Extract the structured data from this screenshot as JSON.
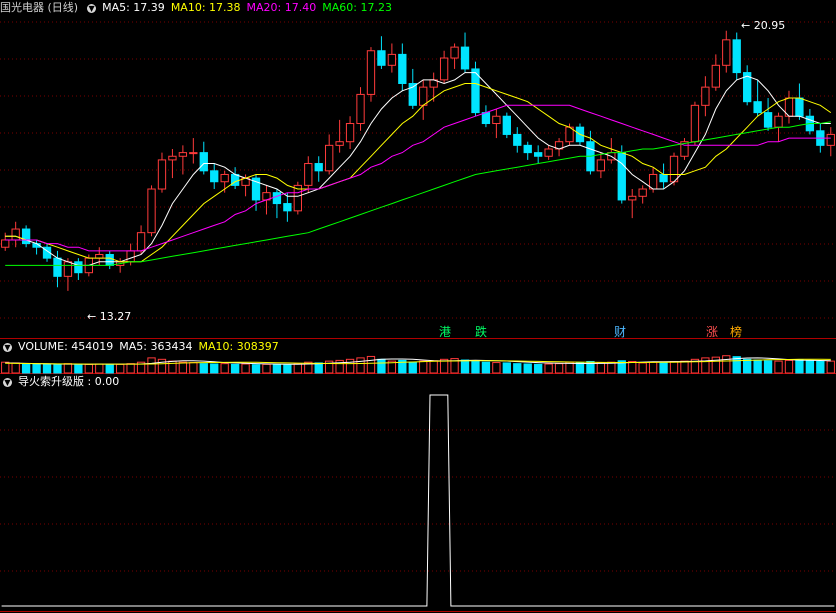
{
  "main": {
    "title": "国光电器 (日线)",
    "ma5": "MA5: 17.39",
    "ma10": "MA10: 17.38",
    "ma20": "MA20: 17.40",
    "ma60": "MA60: 17.23",
    "high_label": "20.95",
    "low_label": "13.27",
    "tags": [
      "港",
      "跌",
      "财",
      "涨",
      "榜"
    ]
  },
  "volume": {
    "label": "VOLUME: 454019",
    "ma5": "MA5: 363434",
    "ma10": "MA10: 308397"
  },
  "indicator": {
    "label": "导火索升级版 : 0.00"
  },
  "colors": {
    "up": "#ff3b3b",
    "down": "#00e4ff",
    "ma5": "#ffffff",
    "ma10": "#ffff00",
    "ma20": "#ff00ff",
    "ma60": "#00ff00",
    "grid": "#7a0000"
  },
  "chart_data": [
    {
      "type": "candlestick",
      "ohlc": [
        [
          15.0,
          15.4,
          14.9,
          15.2
        ],
        [
          15.2,
          15.7,
          15.0,
          15.5
        ],
        [
          15.5,
          15.6,
          15.0,
          15.1
        ],
        [
          15.1,
          15.2,
          14.8,
          15.0
        ],
        [
          15.0,
          15.1,
          14.6,
          14.7
        ],
        [
          14.7,
          14.9,
          13.9,
          14.2
        ],
        [
          14.2,
          14.7,
          13.8,
          14.6
        ],
        [
          14.6,
          14.7,
          14.1,
          14.3
        ],
        [
          14.3,
          14.8,
          14.2,
          14.7
        ],
        [
          14.7,
          15.0,
          14.5,
          14.8
        ],
        [
          14.8,
          14.9,
          14.4,
          14.5
        ],
        [
          14.5,
          14.7,
          14.3,
          14.6
        ],
        [
          14.6,
          15.1,
          14.5,
          14.9
        ],
        [
          14.9,
          15.6,
          14.8,
          15.4
        ],
        [
          15.4,
          16.7,
          15.3,
          16.6
        ],
        [
          16.6,
          17.6,
          16.5,
          17.4
        ],
        [
          17.4,
          17.7,
          16.9,
          17.5
        ],
        [
          17.5,
          17.8,
          17.0,
          17.6
        ],
        [
          17.6,
          18.0,
          17.3,
          17.6
        ],
        [
          17.6,
          17.9,
          17.0,
          17.1
        ],
        [
          17.1,
          17.3,
          16.6,
          16.8
        ],
        [
          16.8,
          17.1,
          16.5,
          17.0
        ],
        [
          17.0,
          17.2,
          16.6,
          16.7
        ],
        [
          16.7,
          17.0,
          16.4,
          16.9
        ],
        [
          16.9,
          17.0,
          16.0,
          16.3
        ],
        [
          16.3,
          16.7,
          15.9,
          16.5
        ],
        [
          16.5,
          16.6,
          15.8,
          16.2
        ],
        [
          16.2,
          16.5,
          15.7,
          16.0
        ],
        [
          16.0,
          16.8,
          15.9,
          16.7
        ],
        [
          16.7,
          17.5,
          16.5,
          17.3
        ],
        [
          17.3,
          17.5,
          16.8,
          17.1
        ],
        [
          17.1,
          18.1,
          17.0,
          17.8
        ],
        [
          17.8,
          18.5,
          17.6,
          17.9
        ],
        [
          17.9,
          18.6,
          17.7,
          18.4
        ],
        [
          18.4,
          19.4,
          18.2,
          19.2
        ],
        [
          19.2,
          20.5,
          19.0,
          20.4
        ],
        [
          20.4,
          20.8,
          19.9,
          20.0
        ],
        [
          20.0,
          20.6,
          19.8,
          20.3
        ],
        [
          20.3,
          20.6,
          19.3,
          19.5
        ],
        [
          19.5,
          19.9,
          18.8,
          18.9
        ],
        [
          18.9,
          19.6,
          18.5,
          19.4
        ],
        [
          19.4,
          19.8,
          19.0,
          19.6
        ],
        [
          19.6,
          20.4,
          19.5,
          20.2
        ],
        [
          20.2,
          20.6,
          19.9,
          20.5
        ],
        [
          20.5,
          20.9,
          19.8,
          19.9
        ],
        [
          19.9,
          20.1,
          18.6,
          18.7
        ],
        [
          18.7,
          18.9,
          18.3,
          18.4
        ],
        [
          18.4,
          18.8,
          18.0,
          18.6
        ],
        [
          18.6,
          18.7,
          18.0,
          18.1
        ],
        [
          18.1,
          18.3,
          17.6,
          17.8
        ],
        [
          17.8,
          17.9,
          17.4,
          17.6
        ],
        [
          17.6,
          17.8,
          17.3,
          17.5
        ],
        [
          17.5,
          17.8,
          17.4,
          17.7
        ],
        [
          17.7,
          18.0,
          17.5,
          17.9
        ],
        [
          17.9,
          18.4,
          17.8,
          18.3
        ],
        [
          18.3,
          18.4,
          17.8,
          17.9
        ],
        [
          17.9,
          18.2,
          17.0,
          17.1
        ],
        [
          17.1,
          17.6,
          16.9,
          17.4
        ],
        [
          17.4,
          18.0,
          17.3,
          17.6
        ],
        [
          17.6,
          17.8,
          16.2,
          16.3
        ],
        [
          16.3,
          16.6,
          15.8,
          16.4
        ],
        [
          16.4,
          16.7,
          16.2,
          16.6
        ],
        [
          16.6,
          17.2,
          16.5,
          17.0
        ],
        [
          17.0,
          17.3,
          16.6,
          16.8
        ],
        [
          16.8,
          17.6,
          16.7,
          17.5
        ],
        [
          17.5,
          18.0,
          17.4,
          17.9
        ],
        [
          17.9,
          19.0,
          17.8,
          18.9
        ],
        [
          18.9,
          19.7,
          18.6,
          19.4
        ],
        [
          19.4,
          20.3,
          19.3,
          20.0
        ],
        [
          20.0,
          20.95,
          19.8,
          20.7
        ],
        [
          20.7,
          20.9,
          19.6,
          19.8
        ],
        [
          19.8,
          20.0,
          18.9,
          19.0
        ],
        [
          19.0,
          19.6,
          18.6,
          18.7
        ],
        [
          18.7,
          19.1,
          18.2,
          18.3
        ],
        [
          18.3,
          18.7,
          17.9,
          18.6
        ],
        [
          18.6,
          19.3,
          18.4,
          19.1
        ],
        [
          19.1,
          19.5,
          18.5,
          18.6
        ],
        [
          18.6,
          18.8,
          18.1,
          18.2
        ],
        [
          18.2,
          18.4,
          17.6,
          17.8
        ],
        [
          17.8,
          18.3,
          17.5,
          18.1
        ]
      ],
      "series": [
        {
          "name": "MA5",
          "values": [
            15.3,
            15.3,
            15.2,
            15.1,
            14.9,
            14.7,
            14.6,
            14.5,
            14.5,
            14.6,
            14.6,
            14.6,
            14.7,
            14.8,
            15.1,
            15.6,
            16.2,
            16.6,
            17.0,
            17.3,
            17.3,
            17.2,
            17.0,
            16.9,
            16.8,
            16.7,
            16.6,
            16.4,
            16.4,
            16.5,
            16.6,
            16.9,
            17.2,
            17.5,
            17.9,
            18.4,
            18.8,
            19.1,
            19.3,
            19.4,
            19.6,
            19.6,
            19.5,
            19.6,
            19.8,
            19.8,
            19.5,
            19.2,
            18.9,
            18.6,
            18.3,
            18.0,
            17.8,
            17.7,
            17.8,
            17.8,
            17.7,
            17.6,
            17.5,
            17.3,
            17.0,
            16.8,
            16.6,
            16.6,
            16.8,
            17.1,
            17.6,
            18.1,
            18.8,
            19.3,
            19.6,
            19.7,
            19.6,
            19.3,
            18.9,
            18.6,
            18.6,
            18.5,
            18.4,
            18.4
          ]
        },
        {
          "name": "MA10",
          "values": [
            15.3,
            15.3,
            15.2,
            15.2,
            15.1,
            15.0,
            14.9,
            14.8,
            14.7,
            14.7,
            14.7,
            14.6,
            14.6,
            14.6,
            14.8,
            15.0,
            15.3,
            15.6,
            15.9,
            16.2,
            16.4,
            16.6,
            16.8,
            16.9,
            17.0,
            17.0,
            16.9,
            16.7,
            16.6,
            16.6,
            16.6,
            16.7,
            16.8,
            16.9,
            17.2,
            17.5,
            17.8,
            18.1,
            18.4,
            18.6,
            18.9,
            19.1,
            19.3,
            19.4,
            19.5,
            19.5,
            19.4,
            19.3,
            19.2,
            19.1,
            19.0,
            18.8,
            18.6,
            18.4,
            18.3,
            18.1,
            18.0,
            17.8,
            17.7,
            17.6,
            17.5,
            17.3,
            17.2,
            17.0,
            17.0,
            17.0,
            17.1,
            17.2,
            17.5,
            17.7,
            18.0,
            18.3,
            18.6,
            18.8,
            19.0,
            19.1,
            19.1,
            19.0,
            18.9,
            18.7
          ]
        },
        {
          "name": "MA20",
          "values": [
            15.2,
            15.2,
            15.2,
            15.2,
            15.1,
            15.1,
            15.0,
            15.0,
            14.9,
            14.9,
            14.9,
            14.9,
            14.9,
            14.9,
            15.0,
            15.1,
            15.2,
            15.3,
            15.4,
            15.5,
            15.6,
            15.7,
            15.9,
            16.0,
            16.2,
            16.3,
            16.4,
            16.5,
            16.5,
            16.6,
            16.6,
            16.7,
            16.8,
            16.9,
            17.0,
            17.2,
            17.3,
            17.5,
            17.6,
            17.8,
            17.9,
            18.1,
            18.3,
            18.4,
            18.5,
            18.6,
            18.7,
            18.8,
            18.9,
            18.9,
            18.9,
            18.9,
            18.9,
            18.9,
            18.9,
            18.8,
            18.7,
            18.6,
            18.5,
            18.4,
            18.3,
            18.2,
            18.1,
            18.0,
            17.9,
            17.8,
            17.8,
            17.8,
            17.8,
            17.8,
            17.8,
            17.8,
            17.8,
            17.9,
            17.9,
            18.0,
            18.0,
            18.0,
            18.0,
            18.0
          ]
        },
        {
          "name": "MA60",
          "values": [
            14.5,
            14.5,
            14.5,
            14.5,
            14.5,
            14.5,
            14.5,
            14.5,
            14.5,
            14.5,
            14.5,
            14.55,
            14.6,
            14.6,
            14.65,
            14.7,
            14.75,
            14.8,
            14.85,
            14.9,
            14.95,
            15.0,
            15.05,
            15.1,
            15.15,
            15.2,
            15.25,
            15.3,
            15.35,
            15.4,
            15.5,
            15.6,
            15.7,
            15.8,
            15.9,
            16.0,
            16.1,
            16.2,
            16.3,
            16.4,
            16.5,
            16.6,
            16.7,
            16.8,
            16.9,
            17.0,
            17.05,
            17.1,
            17.15,
            17.2,
            17.25,
            17.3,
            17.35,
            17.4,
            17.45,
            17.5,
            17.5,
            17.55,
            17.6,
            17.6,
            17.65,
            17.7,
            17.7,
            17.75,
            17.8,
            17.85,
            17.9,
            17.95,
            18.0,
            18.05,
            18.1,
            18.15,
            18.2,
            18.25,
            18.3,
            18.3,
            18.35,
            18.4,
            18.4,
            18.45
          ]
        }
      ],
      "max_label": 20.95,
      "min_label": 13.27
    },
    {
      "type": "bar",
      "name": "VOLUME",
      "values": [
        300,
        280,
        260,
        250,
        240,
        230,
        260,
        250,
        240,
        250,
        230,
        240,
        260,
        300,
        420,
        380,
        330,
        300,
        290,
        260,
        250,
        260,
        240,
        250,
        230,
        240,
        230,
        220,
        260,
        300,
        280,
        330,
        350,
        380,
        420,
        460,
        380,
        330,
        350,
        300,
        330,
        340,
        380,
        400,
        360,
        330,
        300,
        290,
        280,
        260,
        250,
        240,
        250,
        260,
        300,
        280,
        320,
        290,
        300,
        340,
        320,
        280,
        300,
        290,
        320,
        330,
        380,
        420,
        440,
        480,
        454,
        380,
        360,
        340,
        330,
        350,
        360,
        340,
        320,
        330
      ],
      "ma5": [
        280,
        275,
        268,
        262,
        256,
        250,
        248,
        246,
        244,
        246,
        246,
        246,
        246,
        250,
        268,
        296,
        322,
        340,
        340,
        330,
        310,
        290,
        280,
        270,
        262,
        254,
        248,
        244,
        244,
        250,
        258,
        270,
        286,
        300,
        322,
        350,
        382,
        390,
        390,
        380,
        360,
        342,
        336,
        342,
        348,
        352,
        346,
        340,
        332,
        318,
        302,
        290,
        278,
        270,
        266,
        264,
        264,
        266,
        270,
        280,
        292,
        302,
        310,
        312,
        316,
        320,
        326,
        336,
        356,
        376,
        400,
        418,
        420,
        410,
        392,
        372,
        358,
        352,
        346,
        342
      ],
      "ma10": [
        270,
        268,
        265,
        262,
        258,
        254,
        252,
        250,
        248,
        248,
        246,
        246,
        246,
        247,
        250,
        258,
        268,
        278,
        286,
        290,
        292,
        294,
        296,
        298,
        296,
        292,
        286,
        280,
        276,
        272,
        268,
        264,
        262,
        260,
        264,
        270,
        278,
        286,
        296,
        306,
        316,
        324,
        330,
        334,
        336,
        338,
        338,
        338,
        336,
        334,
        328,
        322,
        316,
        310,
        306,
        302,
        298,
        294,
        292,
        292,
        292,
        292,
        294,
        296,
        300,
        306,
        312,
        318,
        326,
        334,
        342,
        350,
        358,
        366,
        372,
        376,
        380,
        382,
        380,
        378
      ]
    },
    {
      "type": "line",
      "name": "导火索升级版",
      "values": [
        0,
        0,
        0,
        0,
        0,
        0,
        0,
        0,
        0,
        0,
        0,
        0,
        0,
        0,
        0,
        0,
        0,
        0,
        0,
        0,
        0,
        0,
        0,
        0,
        0,
        0,
        0,
        0,
        0,
        0,
        0,
        0,
        0,
        0,
        0,
        0,
        0,
        0,
        0,
        0,
        0,
        1,
        1,
        0,
        0,
        0,
        0,
        0,
        0,
        0,
        0,
        0,
        0,
        0,
        0,
        0,
        0,
        0,
        0,
        0,
        0,
        0,
        0,
        0,
        0,
        0,
        0,
        0,
        0,
        0,
        0,
        0,
        0,
        0,
        0,
        0,
        0,
        0,
        0,
        0
      ],
      "ylim": [
        0,
        1
      ]
    }
  ]
}
